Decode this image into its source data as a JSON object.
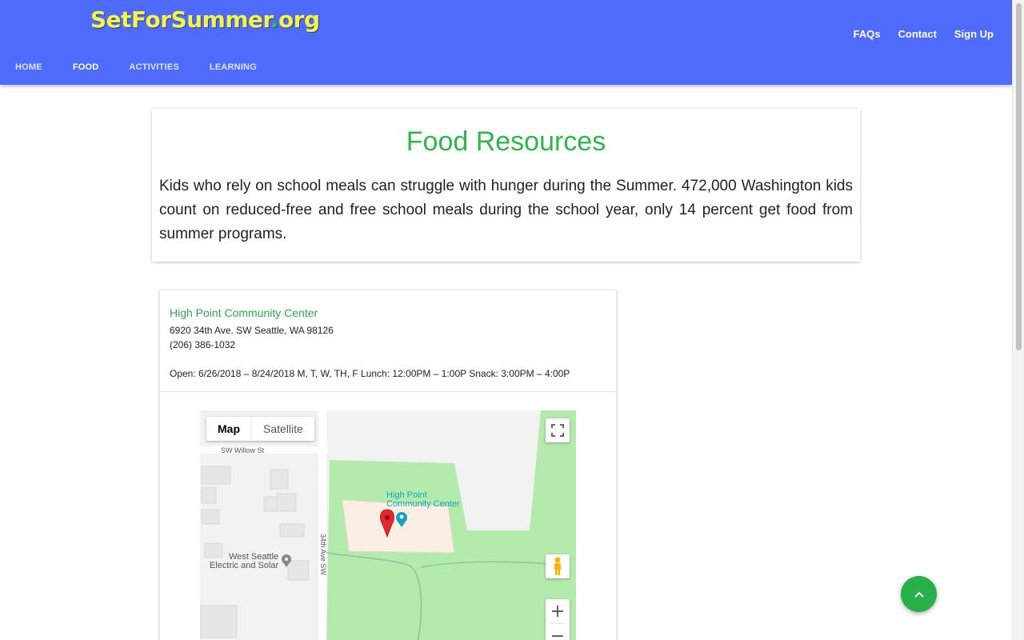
{
  "header": {
    "logo_main": "SetForSummer",
    "logo_dot": ".",
    "logo_tld": "org",
    "top_links": [
      "FAQs",
      "Contact",
      "Sign Up"
    ],
    "nav": [
      "HOME",
      "FOOD",
      "ACTIVITIES",
      "LEARNING"
    ],
    "active_nav": "FOOD",
    "bg_color": "#4f6bfb"
  },
  "intro": {
    "title": "Food Resources",
    "text": "Kids who rely on school meals can struggle with hunger during the Summer. 472,000 Washington kids count on reduced-free and free school meals during the school year, only 14 percent get food from summer programs."
  },
  "location": {
    "name": "High Point Community Center",
    "address": "6920 34th Ave. SW Seattle, WA 98126",
    "phone": "(206) 386-1032",
    "hours": "Open: 6/26/2018 – 8/24/2018 M, T, W, TH, F Lunch: 12:00PM – 1:00P Snack: 3:00PM – 4:00P"
  },
  "map": {
    "type_buttons": [
      "Map",
      "Satellite"
    ],
    "active_type": "Map",
    "labels": {
      "street_willow": "SW Willow St",
      "street_34th": "34th Ave SW",
      "place_line1": "High Point",
      "place_line2": "Community Center",
      "poi_line1": "West Seattle",
      "poi_line2": "Electric and Solar"
    },
    "zoom_in": "+",
    "zoom_out": "−"
  },
  "back_to_top": "^",
  "colors": {
    "accent_green": "#2db84a",
    "park_green": "#b2ebab"
  },
  "icons": [
    "fullscreen-icon",
    "pegman-icon",
    "map-pin-icon",
    "poi-pin-icon",
    "chevron-up-icon"
  ]
}
